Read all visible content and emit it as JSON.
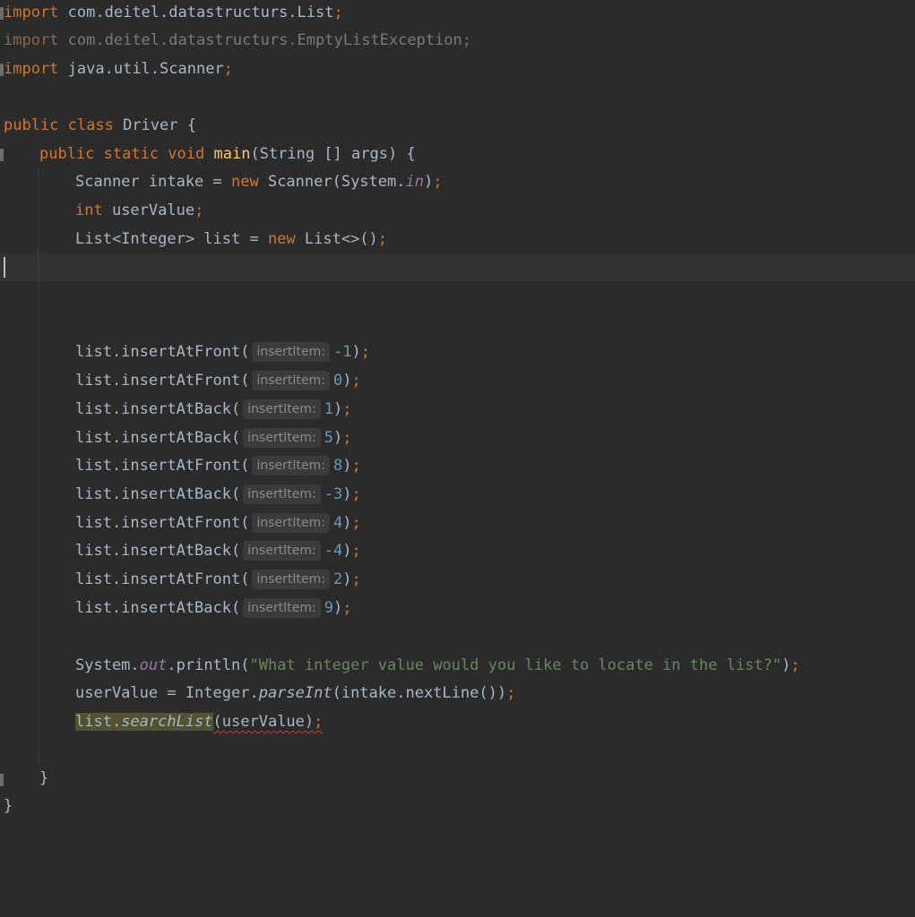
{
  "editor": {
    "imports": [
      {
        "keyword": "import",
        "path": "com.deitel.datastructurs.List",
        "semi": ";",
        "dimmed": false
      },
      {
        "keyword": "import",
        "path": "com.deitel.datastructurs.EmptyListException",
        "semi": ";",
        "dimmed": true
      },
      {
        "keyword": "import",
        "path": "java.util.Scanner",
        "semi": ";",
        "dimmed": false
      }
    ],
    "class_decl": {
      "modifiers": "public class",
      "name": "Driver",
      "open_brace": "{"
    },
    "main_decl": {
      "modifiers": "public static void",
      "method_name": "main",
      "params": "(String [] args) {"
    },
    "declarations": {
      "scanner_line": {
        "lhs": "Scanner intake = ",
        "new_kw": "new",
        "ctor": " Scanner(System.",
        "field": "in",
        "close": ")",
        "semi": ";"
      },
      "int_line": {
        "type_kw": "int",
        "name": " userValue",
        "semi": ";"
      },
      "list_line": {
        "lhs": "List<Integer> list = ",
        "new_kw": "new",
        "ctor": " List<>()",
        "semi": ";"
      }
    },
    "insert_calls": [
      {
        "method": "list.insertAtFront(",
        "hint": "insertItem:",
        "arg": "-1"
      },
      {
        "method": "list.insertAtFront(",
        "hint": "insertItem:",
        "arg": "0"
      },
      {
        "method": "list.insertAtBack(",
        "hint": "insertItem:",
        "arg": "1"
      },
      {
        "method": "list.insertAtBack(",
        "hint": "insertItem:",
        "arg": "5"
      },
      {
        "method": "list.insertAtFront(",
        "hint": "insertItem:",
        "arg": "8"
      },
      {
        "method": "list.insertAtBack(",
        "hint": "insertItem:",
        "arg": "-3"
      },
      {
        "method": "list.insertAtFront(",
        "hint": "insertItem:",
        "arg": "4"
      },
      {
        "method": "list.insertAtBack(",
        "hint": "insertItem:",
        "arg": "-4"
      },
      {
        "method": "list.insertAtFront(",
        "hint": "insertItem:",
        "arg": "2"
      },
      {
        "method": "list.insertAtBack(",
        "hint": "insertItem:",
        "arg": "9"
      }
    ],
    "call_close": ")",
    "call_semi": ";",
    "println_line": {
      "prefix": "System.",
      "field": "out",
      "method": ".println(",
      "string": "\"What integer value would you like to locate in the list?\"",
      "close": ")",
      "semi": ";"
    },
    "parse_line": {
      "prefix": "userValue = Integer.",
      "static_method": "parseInt",
      "args": "(intake.nextLine())",
      "semi": ";"
    },
    "search_line": {
      "obj": "list.",
      "method": "searchList",
      "args": "(userValue)",
      "semi": ";"
    },
    "closing_braces": {
      "method_close": "}",
      "class_close": "}"
    },
    "colors": {
      "background": "#2b2b2b",
      "keyword": "#cc7832",
      "method_decl": "#ffc66d",
      "number": "#6897bb",
      "string": "#6a8759",
      "field": "#9876aa",
      "default_text": "#a9b7c6"
    }
  }
}
